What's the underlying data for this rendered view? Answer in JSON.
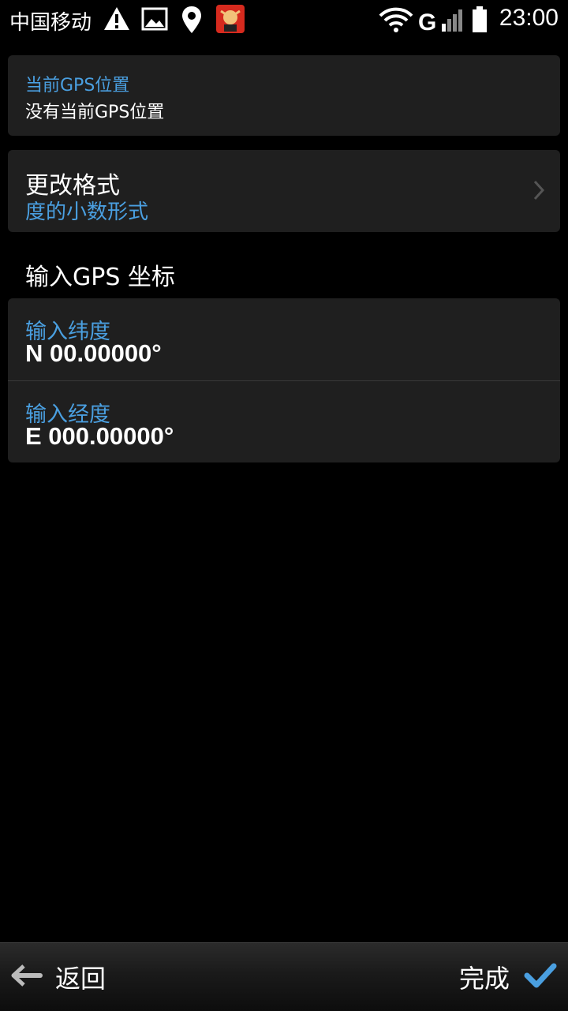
{
  "status_bar": {
    "carrier": "中国移动",
    "time": "23:00",
    "network_label": "G"
  },
  "current_gps": {
    "title": "当前GPS位置",
    "value": "没有当前GPS位置"
  },
  "format": {
    "title": "更改格式",
    "value": "度的小数形式"
  },
  "section_label": "输入GPS 坐标",
  "latitude": {
    "label": "输入纬度",
    "value": "N 00.00000°"
  },
  "longitude": {
    "label": "输入经度",
    "value": "E 000.00000°"
  },
  "bottom_bar": {
    "back_label": "返回",
    "done_label": "完成"
  },
  "colors": {
    "accent": "#4a9fe0",
    "card": "#1f1f1f",
    "background": "#000000"
  },
  "icons": [
    "warning-icon",
    "image-icon",
    "location-pin-icon",
    "app-icon",
    "wifi-icon",
    "signal-icon",
    "battery-icon",
    "chevron-right-icon",
    "back-arrow-icon",
    "checkmark-icon"
  ]
}
